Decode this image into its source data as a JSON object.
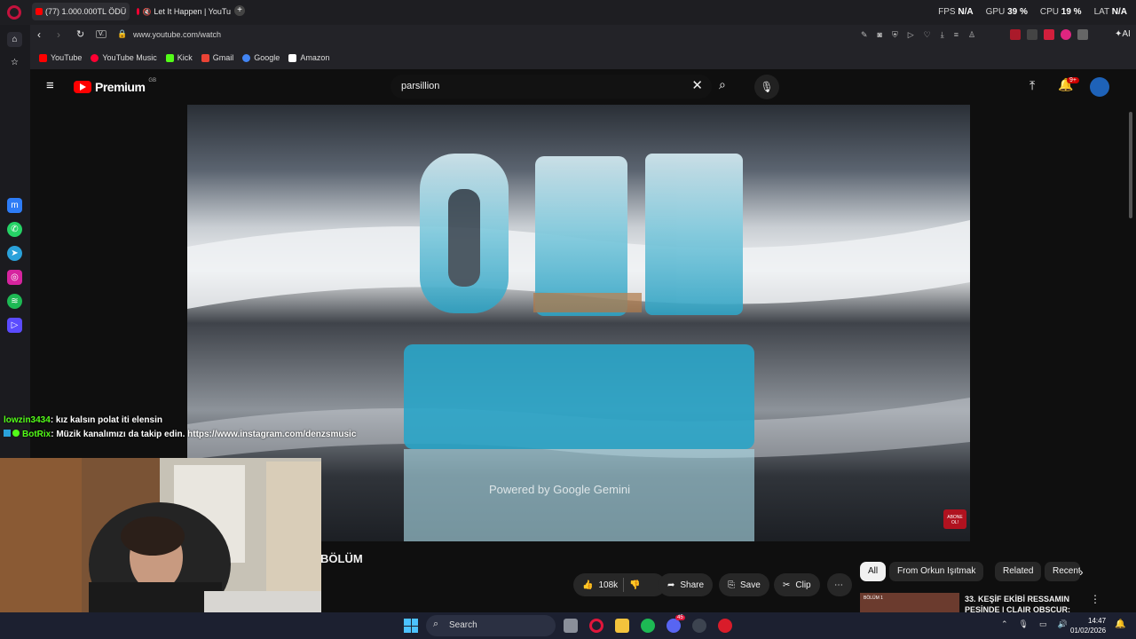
{
  "browser": {
    "tabs": [
      {
        "label": "(77) 1.000.000TL ÖDÜ",
        "active": true
      },
      {
        "label": "Let It Happen | YouTu",
        "active": false
      }
    ],
    "stats": {
      "fps_label": "FPS",
      "fps": "N/A",
      "gpu_label": "GPU",
      "gpu": "39 %",
      "cpu_label": "CPU",
      "cpu": "19 %",
      "lat_label": "LAT",
      "lat": "N/A"
    },
    "ai_label": "AI",
    "url": "www.youtube.com/watch",
    "url_badge": "V.",
    "bookmarks": [
      {
        "label": "YouTube",
        "color": "#ff0000"
      },
      {
        "label": "YouTube Music",
        "color": "#ff0033"
      },
      {
        "label": "Kick",
        "color": "#53fc18"
      },
      {
        "label": "Gmail",
        "color": "#ea4335"
      },
      {
        "label": "Google",
        "color": "#4285f4"
      },
      {
        "label": "Amazon",
        "color": "#ffffff"
      }
    ]
  },
  "youtube": {
    "logo": "Premium",
    "country_code": "GB",
    "search_value": "parsillion",
    "notifications_badge": "9+",
    "video_watermark": "Powered by  Google Gemini",
    "corner_badge": "ABONE OL!",
    "title": "BÖLÜM",
    "actions": {
      "likes": "108k",
      "share": "Share",
      "save": "Save",
      "clip": "Clip"
    },
    "chips": [
      "All",
      "From Orkun Işıtmak",
      "Related",
      "Recent"
    ],
    "rec": {
      "title_line1": "33. KEŞİF EKİBİ RESSAMIN",
      "title_line2": "PEŞİNDE | CLAIR OBSCUR:",
      "thumb_label": "BÖLÜM 1"
    }
  },
  "chat": [
    {
      "user": "lowzin3434",
      "user_color": "#53fc18",
      "text": ": kız kalsın polat iti elensin"
    },
    {
      "user": "BotRix",
      "user_color": "#53fc18",
      "text": ": Müzik kanalımızı da takip edin. https://www.instagram.com/denzsmusic"
    }
  ],
  "taskbar": {
    "search_label": "Search",
    "discord_badge": "45",
    "time": "14:47",
    "date": "01/02/2026"
  }
}
